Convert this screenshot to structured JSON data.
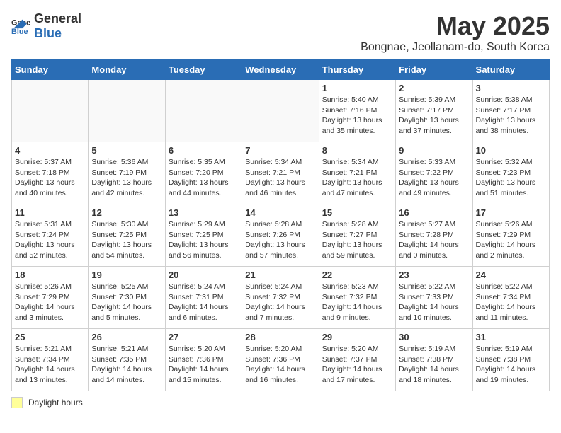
{
  "logo": {
    "general": "General",
    "blue": "Blue"
  },
  "title": "May 2025",
  "subtitle": "Bongnae, Jeollanam-do, South Korea",
  "days_of_week": [
    "Sunday",
    "Monday",
    "Tuesday",
    "Wednesday",
    "Thursday",
    "Friday",
    "Saturday"
  ],
  "weeks": [
    [
      {
        "day": "",
        "info": ""
      },
      {
        "day": "",
        "info": ""
      },
      {
        "day": "",
        "info": ""
      },
      {
        "day": "",
        "info": ""
      },
      {
        "day": "1",
        "info": "Sunrise: 5:40 AM\nSunset: 7:16 PM\nDaylight: 13 hours\nand 35 minutes."
      },
      {
        "day": "2",
        "info": "Sunrise: 5:39 AM\nSunset: 7:17 PM\nDaylight: 13 hours\nand 37 minutes."
      },
      {
        "day": "3",
        "info": "Sunrise: 5:38 AM\nSunset: 7:17 PM\nDaylight: 13 hours\nand 38 minutes."
      }
    ],
    [
      {
        "day": "4",
        "info": "Sunrise: 5:37 AM\nSunset: 7:18 PM\nDaylight: 13 hours\nand 40 minutes."
      },
      {
        "day": "5",
        "info": "Sunrise: 5:36 AM\nSunset: 7:19 PM\nDaylight: 13 hours\nand 42 minutes."
      },
      {
        "day": "6",
        "info": "Sunrise: 5:35 AM\nSunset: 7:20 PM\nDaylight: 13 hours\nand 44 minutes."
      },
      {
        "day": "7",
        "info": "Sunrise: 5:34 AM\nSunset: 7:21 PM\nDaylight: 13 hours\nand 46 minutes."
      },
      {
        "day": "8",
        "info": "Sunrise: 5:34 AM\nSunset: 7:21 PM\nDaylight: 13 hours\nand 47 minutes."
      },
      {
        "day": "9",
        "info": "Sunrise: 5:33 AM\nSunset: 7:22 PM\nDaylight: 13 hours\nand 49 minutes."
      },
      {
        "day": "10",
        "info": "Sunrise: 5:32 AM\nSunset: 7:23 PM\nDaylight: 13 hours\nand 51 minutes."
      }
    ],
    [
      {
        "day": "11",
        "info": "Sunrise: 5:31 AM\nSunset: 7:24 PM\nDaylight: 13 hours\nand 52 minutes."
      },
      {
        "day": "12",
        "info": "Sunrise: 5:30 AM\nSunset: 7:25 PM\nDaylight: 13 hours\nand 54 minutes."
      },
      {
        "day": "13",
        "info": "Sunrise: 5:29 AM\nSunset: 7:25 PM\nDaylight: 13 hours\nand 56 minutes."
      },
      {
        "day": "14",
        "info": "Sunrise: 5:28 AM\nSunset: 7:26 PM\nDaylight: 13 hours\nand 57 minutes."
      },
      {
        "day": "15",
        "info": "Sunrise: 5:28 AM\nSunset: 7:27 PM\nDaylight: 13 hours\nand 59 minutes."
      },
      {
        "day": "16",
        "info": "Sunrise: 5:27 AM\nSunset: 7:28 PM\nDaylight: 14 hours\nand 0 minutes."
      },
      {
        "day": "17",
        "info": "Sunrise: 5:26 AM\nSunset: 7:29 PM\nDaylight: 14 hours\nand 2 minutes."
      }
    ],
    [
      {
        "day": "18",
        "info": "Sunrise: 5:26 AM\nSunset: 7:29 PM\nDaylight: 14 hours\nand 3 minutes."
      },
      {
        "day": "19",
        "info": "Sunrise: 5:25 AM\nSunset: 7:30 PM\nDaylight: 14 hours\nand 5 minutes."
      },
      {
        "day": "20",
        "info": "Sunrise: 5:24 AM\nSunset: 7:31 PM\nDaylight: 14 hours\nand 6 minutes."
      },
      {
        "day": "21",
        "info": "Sunrise: 5:24 AM\nSunset: 7:32 PM\nDaylight: 14 hours\nand 7 minutes."
      },
      {
        "day": "22",
        "info": "Sunrise: 5:23 AM\nSunset: 7:32 PM\nDaylight: 14 hours\nand 9 minutes."
      },
      {
        "day": "23",
        "info": "Sunrise: 5:22 AM\nSunset: 7:33 PM\nDaylight: 14 hours\nand 10 minutes."
      },
      {
        "day": "24",
        "info": "Sunrise: 5:22 AM\nSunset: 7:34 PM\nDaylight: 14 hours\nand 11 minutes."
      }
    ],
    [
      {
        "day": "25",
        "info": "Sunrise: 5:21 AM\nSunset: 7:34 PM\nDaylight: 14 hours\nand 13 minutes."
      },
      {
        "day": "26",
        "info": "Sunrise: 5:21 AM\nSunset: 7:35 PM\nDaylight: 14 hours\nand 14 minutes."
      },
      {
        "day": "27",
        "info": "Sunrise: 5:20 AM\nSunset: 7:36 PM\nDaylight: 14 hours\nand 15 minutes."
      },
      {
        "day": "28",
        "info": "Sunrise: 5:20 AM\nSunset: 7:36 PM\nDaylight: 14 hours\nand 16 minutes."
      },
      {
        "day": "29",
        "info": "Sunrise: 5:20 AM\nSunset: 7:37 PM\nDaylight: 14 hours\nand 17 minutes."
      },
      {
        "day": "30",
        "info": "Sunrise: 5:19 AM\nSunset: 7:38 PM\nDaylight: 14 hours\nand 18 minutes."
      },
      {
        "day": "31",
        "info": "Sunrise: 5:19 AM\nSunset: 7:38 PM\nDaylight: 14 hours\nand 19 minutes."
      }
    ]
  ],
  "legend": {
    "box_label": "Daylight hours"
  }
}
